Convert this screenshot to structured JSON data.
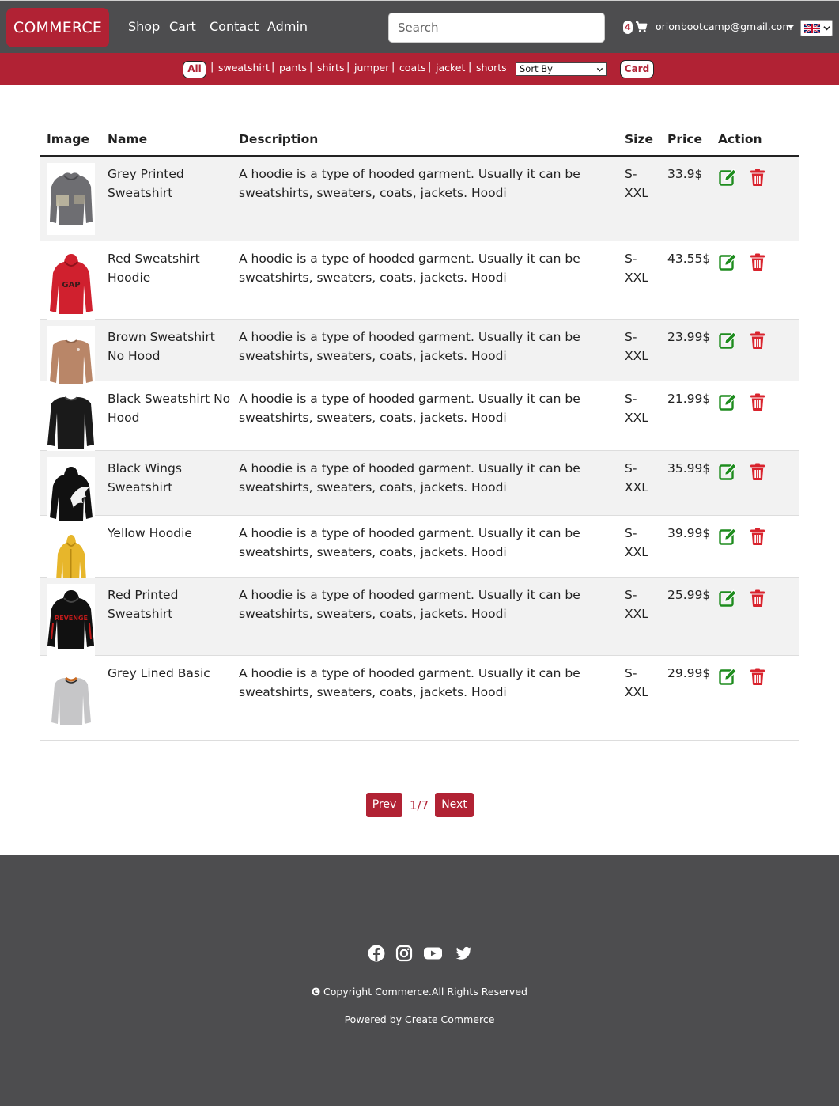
{
  "navbar": {
    "brand": "COMMERCE",
    "links": [
      "Shop",
      "Cart",
      "Contact",
      "Admin"
    ],
    "search_placeholder": "Search",
    "cart_count": "4",
    "user_email": "orionbootcamp@gmail.com",
    "language_icon": "uk-flag-icon"
  },
  "filters": {
    "all_label": "All",
    "categories": [
      "sweatshirt",
      "pants",
      "shirts",
      "jumper",
      "coats",
      "jacket",
      "shorts"
    ],
    "sort_label": "Sort By",
    "card_label": "Card"
  },
  "table": {
    "headers": [
      "Image",
      "Name",
      "Description",
      "Size",
      "Price",
      "Action"
    ],
    "rows": [
      {
        "name": "Grey Printed Sweatshirt",
        "description": "A hoodie is a type of hooded garment. Usually it can be sweatshirts, sweaters, coats, jackets. Hoodi",
        "size": "S-XXL",
        "price": "33.9$"
      },
      {
        "name": "Red Sweatshirt Hoodie",
        "description": "A hoodie is a type of hooded garment. Usually it can be sweatshirts, sweaters, coats, jackets. Hoodi",
        "size": "S-XXL",
        "price": "43.55$"
      },
      {
        "name": "Brown Sweatshirt No Hood",
        "description": "A hoodie is a type of hooded garment. Usually it can be sweatshirts, sweaters, coats, jackets. Hoodi",
        "size": "S-XXL",
        "price": "23.99$"
      },
      {
        "name": "Black Sweatshirt No Hood",
        "description": "A hoodie is a type of hooded garment. Usually it can be sweatshirts, sweaters, coats, jackets. Hoodi",
        "size": "S-XXL",
        "price": "21.99$"
      },
      {
        "name": "Black Wings Sweatshirt",
        "description": "A hoodie is a type of hooded garment. Usually it can be sweatshirts, sweaters, coats, jackets. Hoodi",
        "size": "S-XXL",
        "price": "35.99$"
      },
      {
        "name": "Yellow Hoodie",
        "description": "A hoodie is a type of hooded garment. Usually it can be sweatshirts, sweaters, coats, jackets. Hoodi",
        "size": "S-XXL",
        "price": "39.99$"
      },
      {
        "name": "Red Printed Sweatshirt",
        "description": "A hoodie is a type of hooded garment. Usually it can be sweatshirts, sweaters, coats, jackets. Hoodi",
        "size": "S-XXL",
        "price": "25.99$"
      },
      {
        "name": "Grey Lined Basic",
        "description": "A hoodie is a type of hooded garment. Usually it can be sweatshirts, sweaters, coats, jackets. Hoodi",
        "size": "S-XXL",
        "price": "29.99$"
      }
    ]
  },
  "pagination": {
    "prev_label": "Prev",
    "next_label": "Next",
    "indicator": "1/7"
  },
  "footer": {
    "social_icons": [
      "facebook-icon",
      "instagram-icon",
      "youtube-icon",
      "twitter-icon"
    ],
    "copyright": "Copyright Commerce.All Rights Reserved",
    "powered_prefix": "Powered by",
    "powered_link": "Create Commerce"
  },
  "colors": {
    "brand": "#b12234",
    "navbar": "#4d4d4f",
    "edit": "#1e8c1e",
    "delete": "#d9232d"
  }
}
